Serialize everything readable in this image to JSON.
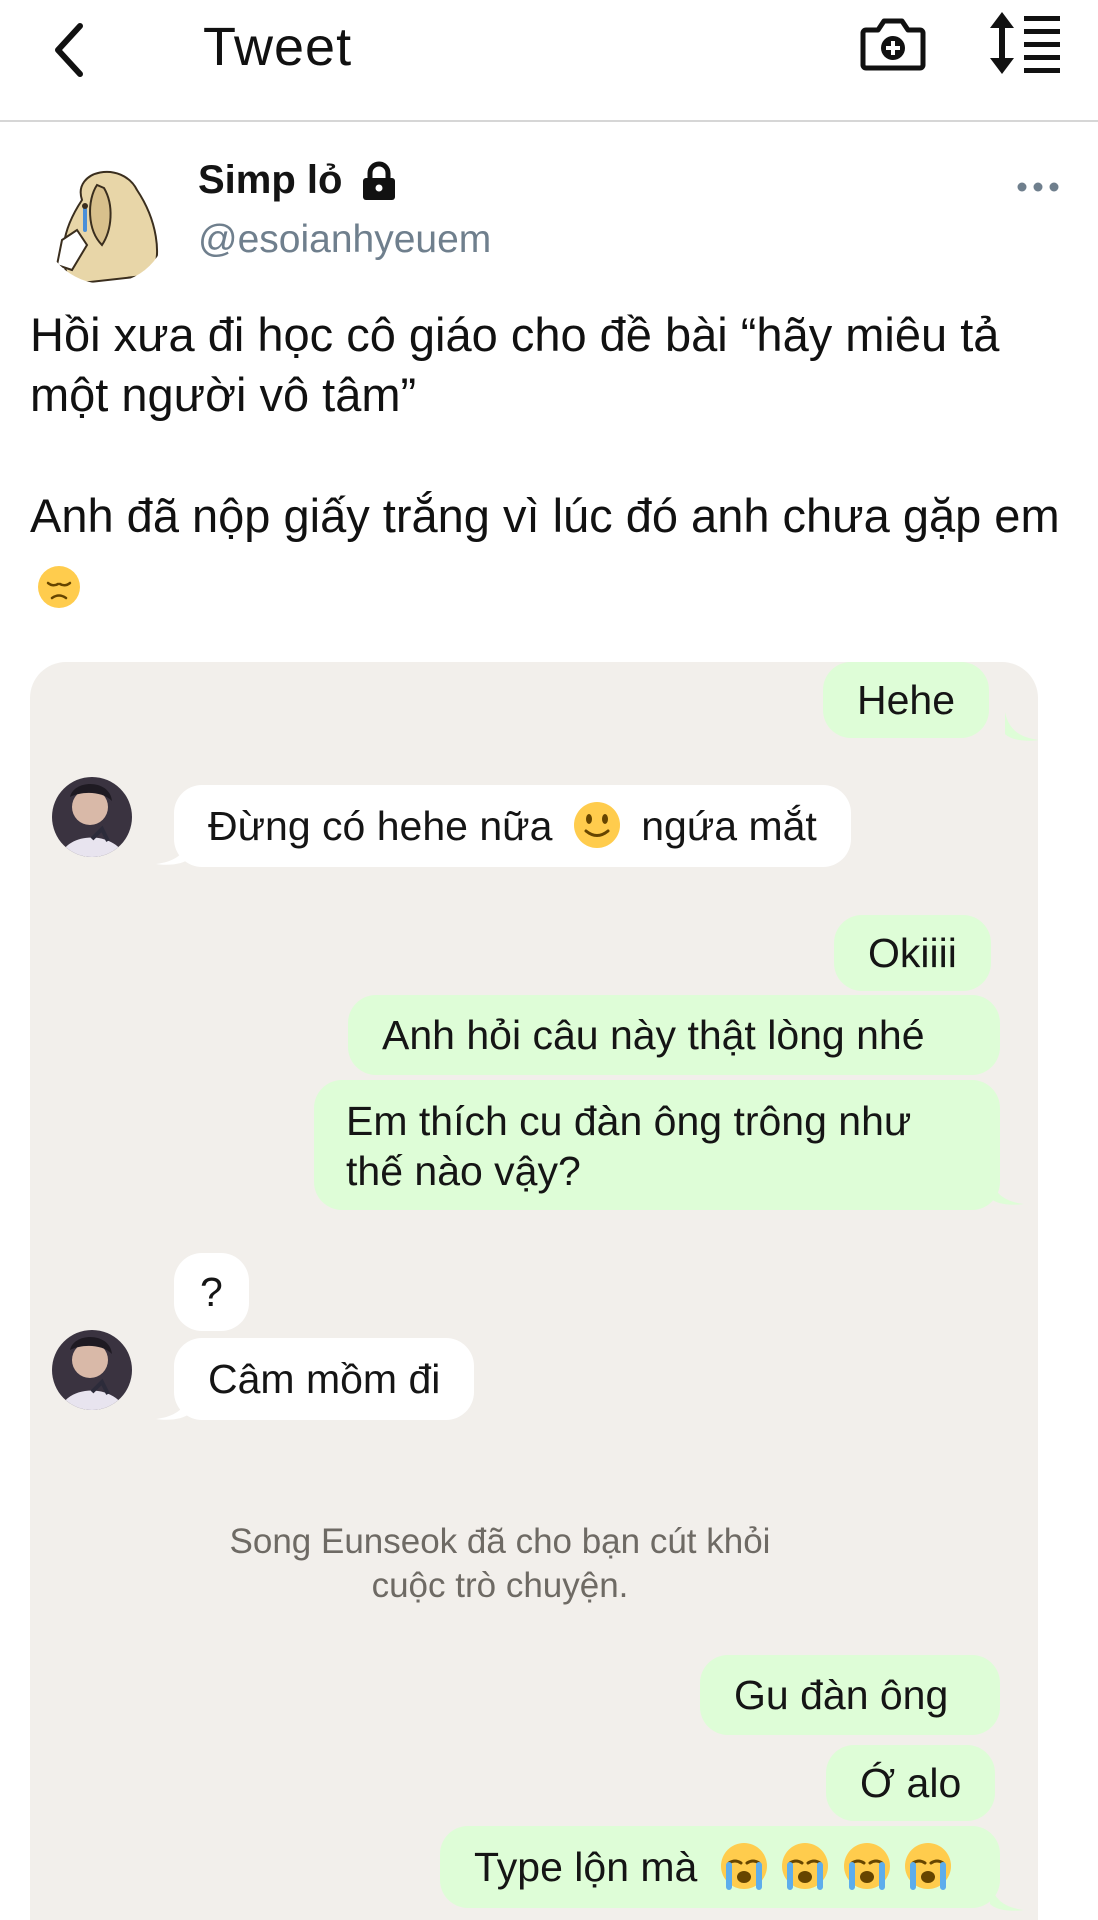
{
  "nav": {
    "back_icon": "chevron-left-icon",
    "title": "Tweet",
    "camera_icon": "camera-plus-icon",
    "sort_icon": "sort-list-icon"
  },
  "tweet": {
    "display_name": "Simp lỏ",
    "lock_icon": "lock-icon",
    "handle": "@esoianhyeuem",
    "more_icon": "more-horizontal-icon",
    "text_para1": "Hồi xưa đi học cô giáo cho đề bài “hãy miêu tả một người vô tâm”",
    "text_para2": "Anh đã nộp giấy trắng vì lúc đó anh chưa gặp em",
    "text_para2_emoji": "disappointed-face-emoji"
  },
  "chat": {
    "messages": [
      {
        "side": "out",
        "text": "Hehe"
      },
      {
        "side": "in",
        "text_before": "Đừng có hehe nữa",
        "emoji": "slightly-smiling-face-emoji",
        "text_after": "ngứa mắt"
      },
      {
        "side": "out",
        "text": "Okiiii"
      },
      {
        "side": "out",
        "text": "Anh hỏi câu này thật lòng nhé"
      },
      {
        "side": "out",
        "text": "Em thích cu đàn ông trông như thế nào vậy?"
      },
      {
        "side": "in",
        "text": "?"
      },
      {
        "side": "in",
        "text": "Câm mồm đi"
      },
      {
        "side": "out",
        "text": "Gu đàn ông"
      },
      {
        "side": "out",
        "text": "Ớ alo"
      },
      {
        "side": "out",
        "text": "Type lộn mà",
        "emoji": "loudly-crying-face-emoji",
        "emoji_count": 4
      }
    ],
    "system_message": "Song Eunseok đã cho bạn cút khỏi\ncuộc trò chuyện."
  },
  "colors": {
    "chat_background": "#f2efeb",
    "outgoing_bubble": "#defdd7",
    "incoming_bubble": "#ffffff",
    "handle_gray": "#6f7f8d",
    "system_text": "#6e6a64"
  }
}
